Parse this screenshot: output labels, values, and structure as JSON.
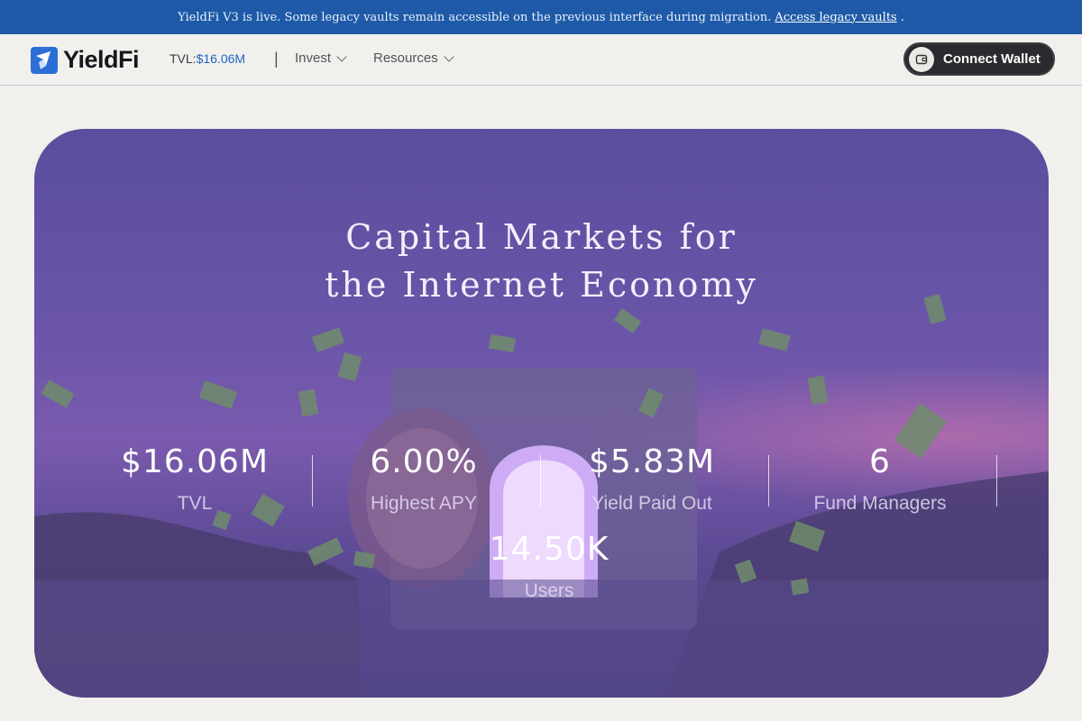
{
  "announcement": {
    "text": "YieldFi V3 is live. Some legacy vaults remain accessible on the previous interface during migration.",
    "link": "Access legacy vaults",
    "suffix": "."
  },
  "nav": {
    "logo_text": "YieldFi",
    "tvl_label": "TVL:",
    "tvl_value": "$16.06M",
    "separator": "|",
    "links": [
      {
        "label": "Invest",
        "icon": "chevron-down-icon"
      },
      {
        "label": "Resources",
        "icon": "chevron-down-icon"
      }
    ],
    "wallet_button": {
      "label": "Connect Wallet",
      "icon": "wallet-icon"
    }
  },
  "hero": {
    "title_line1": "Capital Markets for",
    "title_line2": "the Internet Economy",
    "stats": [
      {
        "value": "$16.06M",
        "label": "TVL"
      },
      {
        "value": "6.00%",
        "label": "Highest APY"
      },
      {
        "value": "$5.83M",
        "label": "Yield Paid Out"
      },
      {
        "value": "6",
        "label": "Fund Managers"
      },
      {
        "value": "14.50K",
        "label": "Users"
      }
    ]
  },
  "colors": {
    "announcement_bg": "#1e5aa8",
    "accent_blue": "#1f64c8",
    "hero_purple": "#6a55a8",
    "wallet_button_bg": "#2a2b2e"
  }
}
